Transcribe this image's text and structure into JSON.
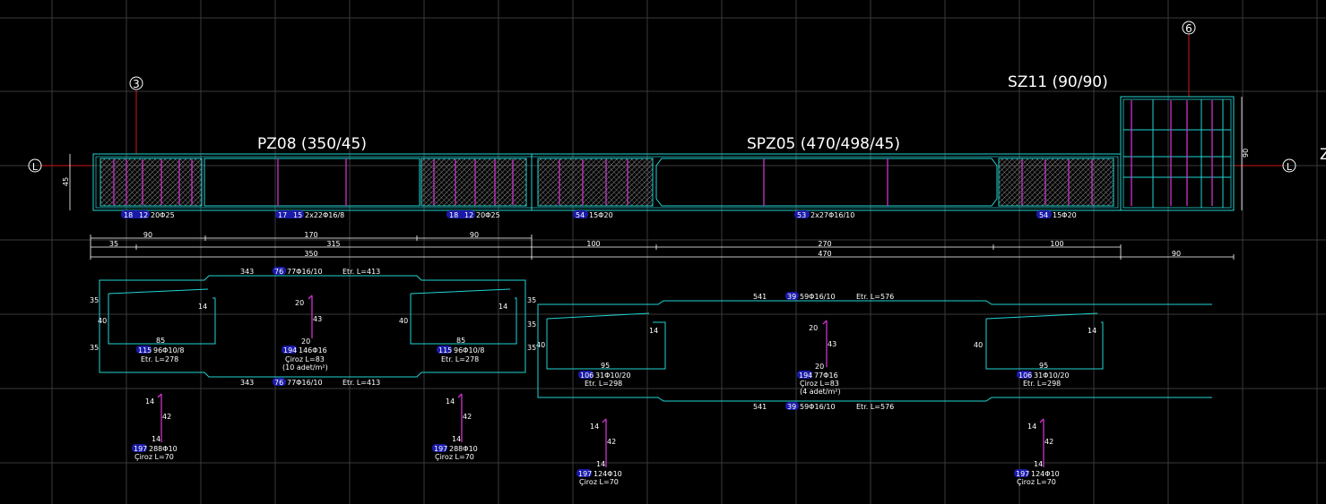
{
  "colors": {
    "background": "#000000",
    "grid": "#3a3a3a",
    "rebar_outline": "#22d3d3",
    "rebar_bar": "#cc33cc",
    "axis_line": "#d01818",
    "badge": "#1a1aa8",
    "text": "#ffffff"
  },
  "axes": {
    "left_axis_3": "3",
    "right_axis_6": "6",
    "row_axis_left": "L",
    "row_axis_right": "L",
    "cut_letter": "Z"
  },
  "titles": {
    "pz08": "PZ08 (350/45)",
    "spz05": "SPZ05 (470/498/45)",
    "sz11": "SZ11 (90/90)"
  },
  "section_labels": {
    "height_45": "45",
    "height_90": "90"
  },
  "bar_marks_top": [
    {
      "num": "18",
      "num2": "12",
      "text": "20Φ25"
    },
    {
      "num": "17",
      "num2": "15",
      "text": "2x22Φ16/8"
    },
    {
      "num": "18",
      "num2": "12",
      "text": "20Φ25"
    },
    {
      "num": "54",
      "text": "15Φ20"
    },
    {
      "num": "53",
      "text": "2x27Φ16/10"
    },
    {
      "num": "54",
      "text": "15Φ20"
    }
  ],
  "dimensions": {
    "row1": [
      "90",
      "170",
      "90"
    ],
    "row2": [
      "35",
      "315",
      "100",
      "270",
      "100"
    ],
    "row3": [
      "350",
      "470",
      "90"
    ]
  },
  "pz08_detail": {
    "top_len": "343",
    "top_badge": "76",
    "top_text": "77Φ16/10",
    "top_etr": "Etr. L=413",
    "bot_len": "343",
    "bot_badge": "76",
    "bot_text": "77Φ16/10",
    "bot_etr": "Etr. L=413",
    "left_35a": "35",
    "left_40": "40",
    "left_35b": "35",
    "mid_40": "40",
    "right_35a": "35",
    "right_35b": "35",
    "right_35c": "35",
    "right_40": "40",
    "stirrup_hook": "14",
    "stirrup_w": "85",
    "stirrup_left": {
      "badge": "115",
      "text": "96Φ10/8",
      "etr": "Etr. L=278"
    },
    "stirrup_right": {
      "badge": "115",
      "text": "96Φ10/8",
      "etr": "Etr. L=278"
    },
    "ciroz": {
      "top": "20",
      "h": "43",
      "bot": "20",
      "badge": "194",
      "text": "146Φ16",
      "len": "Çiroz L=83",
      "note": "(10 adet/m²)"
    }
  },
  "spz05_detail": {
    "top_len": "541",
    "top_badge": "39",
    "top_text": "59Φ16/10",
    "top_etr": "Etr. L=576",
    "bot_len": "541",
    "bot_badge": "39",
    "bot_text": "59Φ16/10",
    "bot_etr": "Etr. L=576",
    "stirrup_left": {
      "w": "95",
      "hook": "14",
      "badge": "106",
      "text": "31Φ10/20",
      "etr": "Etr. L=298"
    },
    "stirrup_right": {
      "w": "95",
      "hook": "14",
      "side": "40",
      "badge": "106",
      "text": "31Φ10/20",
      "etr": "Etr. L=298"
    },
    "ciroz": {
      "top": "20",
      "h": "43",
      "bot": "20",
      "badge": "194",
      "text": "77Φ16",
      "len": "Çiroz L=83",
      "note": "(4 adet/m²)"
    }
  },
  "small_ciroz": [
    {
      "top": "14",
      "h": "42",
      "bot": "14",
      "badge": "197",
      "text": "288Φ10",
      "len": "Çiroz L=70"
    },
    {
      "top": "14",
      "h": "42",
      "bot": "14",
      "badge": "197",
      "text": "288Φ10",
      "len": "Çiroz L=70"
    },
    {
      "top": "14",
      "h": "42",
      "bot": "14",
      "badge": "197",
      "text": "124Φ10",
      "len": "Çiroz L=70"
    },
    {
      "top": "14",
      "h": "42",
      "bot": "14",
      "badge": "197",
      "text": "124Φ10",
      "len": "Çiroz L=70"
    }
  ]
}
